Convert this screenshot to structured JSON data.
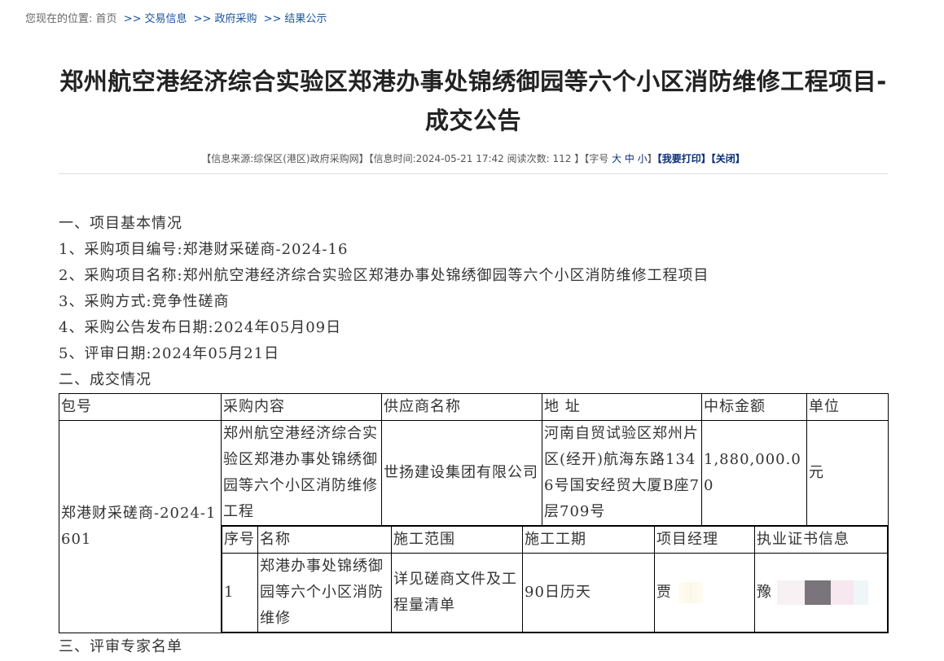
{
  "breadcrumb": {
    "prefix": "您现在的位置:",
    "home": "首页",
    "sep": ">>",
    "level1": "交易信息",
    "level2": "政府采购",
    "level3": "结果公示"
  },
  "title": "郑州航空港经济综合实验区郑港办事处锦绣御园等六个小区消防维修工程项目-成交公告",
  "meta": {
    "source_label": "【信息来源:综保区(港区)政府采购网】",
    "time_label": "【信息时间:2024-05-21 17:42 阅读次数:",
    "read_count": "112",
    "font_size_label": "】【字号",
    "font_large": "大",
    "font_medium": "中",
    "font_small": "小",
    "font_close": "】",
    "print_label": "【我要打印】",
    "close_label": "【关闭】"
  },
  "section1": {
    "heading": "一、项目基本情况",
    "item1": "1、采购项目编号:郑港财采磋商-2024-16",
    "item2": "2、采购项目名称:郑州航空港经济综合实验区郑港办事处锦绣御园等六个小区消防维修工程项目",
    "item3": "3、采购方式:竞争性磋商",
    "item4": "4、采购公告发布日期:2024年05月09日",
    "item5": "5、评审日期:2024年05月21日"
  },
  "section2": {
    "heading": "二、成交情况",
    "headers": {
      "package": "包号",
      "content": "采购内容",
      "supplier": "供应商名称",
      "address": "地 址",
      "amount": "中标金额",
      "unit": "单位"
    },
    "row": {
      "package": "郑港财采磋商-2024-1601",
      "content": "郑州航空港经济综合实验区郑港办事处锦绣御园等六个小区消防维修工程",
      "supplier": "世扬建设集团有限公司",
      "address": "河南自贸试验区郑州片区(经开)航海东路1346号国安经贸大厦B座7层709号",
      "amount": "1,880,000.00",
      "unit": "元"
    },
    "sub_headers": {
      "seq": "序号",
      "name": "名称",
      "scope": "施工范围",
      "period": "施工工期",
      "manager": "项目经理",
      "cert": "执业证书信息"
    },
    "sub_row": {
      "seq": "1",
      "name": "郑港办事处锦绣御园等六个小区消防维修",
      "scope": "详见磋商文件及工程量清单",
      "period": "90日历天",
      "manager": "贾",
      "cert": "豫"
    }
  },
  "section3": {
    "heading": "三、评审专家名单"
  }
}
